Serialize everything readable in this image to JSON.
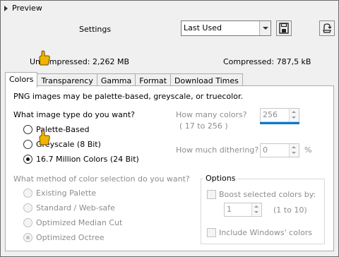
{
  "header": {
    "preview_label": "Preview",
    "settings_label": "Settings"
  },
  "settings_select": {
    "value": "Last Used"
  },
  "sizes": {
    "uncompressed": "Uncompressed:  2,262 MB",
    "compressed": "Compressed: 787,5 kB"
  },
  "tabs": [
    {
      "label": "Colors"
    },
    {
      "label": "Transparency"
    },
    {
      "label": "Gamma"
    },
    {
      "label": "Format"
    },
    {
      "label": "Download Times"
    }
  ],
  "colors_panel": {
    "intro": "PNG images may be palette-based, greyscale, or truecolor.",
    "image_type_question": "What image type do you want?",
    "image_types": [
      {
        "label": "Palette-Based",
        "selected": false
      },
      {
        "label": "Greyscale (8 Bit)",
        "selected": false
      },
      {
        "label": "16.7 Million Colors (24 Bit)",
        "selected": true
      }
    ],
    "how_many_colors_label": "How many colors?",
    "how_many_colors_value": "256",
    "how_many_colors_range": "( 17  to  256 )",
    "dithering_label": "How much dithering?",
    "dithering_value": "0",
    "dithering_unit": "%",
    "method_question": "What method of color selection do you want?",
    "methods": [
      {
        "label": "Existing Palette",
        "selected": false
      },
      {
        "label": "Standard / Web-safe",
        "selected": false
      },
      {
        "label": "Optimized Median Cut",
        "selected": false
      },
      {
        "label": "Optimized Octree",
        "selected": true
      }
    ],
    "options": {
      "title": "Options",
      "boost_label": "Boost selected colors by:",
      "boost_value": "1",
      "boost_range": "(1 to 10)",
      "include_windows_label": "Include Windows' colors"
    }
  }
}
